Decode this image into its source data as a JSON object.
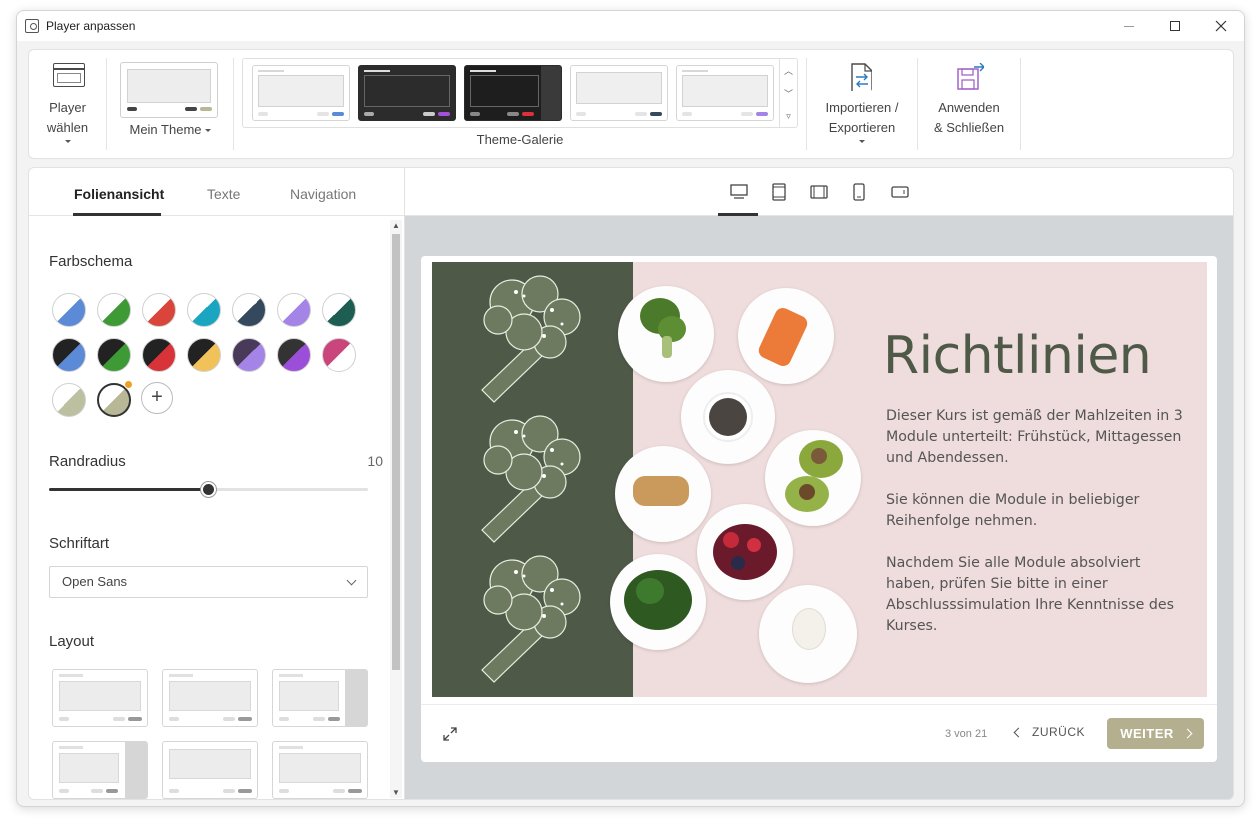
{
  "window": {
    "title": "Player anpassen"
  },
  "ribbon": {
    "player_line1": "Player",
    "player_line2": "wählen",
    "my_theme": "Mein Theme",
    "gallery_label": "Theme-Galerie",
    "import_line1": "Importieren /",
    "import_line2": "Exportieren",
    "apply_line1": "Anwenden",
    "apply_line2": "& Schließen"
  },
  "tabs": {
    "slide_view": "Folienansicht",
    "texts": "Texte",
    "navigation": "Navigation"
  },
  "settings": {
    "color_scheme_title": "Farbschema",
    "border_radius_title": "Randradius",
    "border_radius_value": "10",
    "border_radius_min": 0,
    "border_radius_max": 20,
    "font_title": "Schriftart",
    "font_value": "Open Sans",
    "layout_title": "Layout"
  },
  "swatches": [
    [
      "#ffffff",
      "#5b8ad6"
    ],
    [
      "#ffffff",
      "#3e9a35"
    ],
    [
      "#ffffff",
      "#d9453a"
    ],
    [
      "#ffffff",
      "#1aa6c0"
    ],
    [
      "#ffffff",
      "#34495e"
    ],
    [
      "#ffffff",
      "#a484e6"
    ],
    [
      "#ffffff",
      "#1e5e52"
    ],
    [
      "#222222",
      "#5b8ad6"
    ],
    [
      "#222222",
      "#3e9a35"
    ],
    [
      "#222222",
      "#d9333a"
    ],
    [
      "#222222",
      "#f2c25a"
    ],
    [
      "#4a3a5a",
      "#a484e6"
    ],
    [
      "#333333",
      "#9b4fd8"
    ],
    [
      "#c9457c",
      "#ffffff"
    ],
    [
      "#ffffff",
      "#bcc0a0"
    ],
    [
      "#ffffff",
      "#b8b896"
    ]
  ],
  "colors": {
    "accent": "#b4b08f",
    "slide_bg": "#efdcdc",
    "slide_green": "#4f5948"
  },
  "slide": {
    "title": "Richtlinien",
    "para1": "Dieser Kurs ist gemäß der Mahlzeiten in 3 Module unterteilt: Frühstück, Mittagessen und Abendessen.",
    "para2": "Sie können die Module in beliebiger Reihenfolge nehmen.",
    "para3": "Nachdem Sie alle Module absolviert haben, prüfen Sie bitte in einer Abschlusssimulation Ihre Kenntnisse des Kurses."
  },
  "player": {
    "page_indicator": "3 von 21",
    "back": "ZURÜCK",
    "next": "WEITER"
  },
  "icons": [
    "player-icon",
    "import-export-icon",
    "apply-close-icon",
    "desktop-icon",
    "tablet-portrait-icon",
    "tablet-landscape-icon",
    "phone-portrait-icon",
    "phone-landscape-icon",
    "expand-icon"
  ]
}
